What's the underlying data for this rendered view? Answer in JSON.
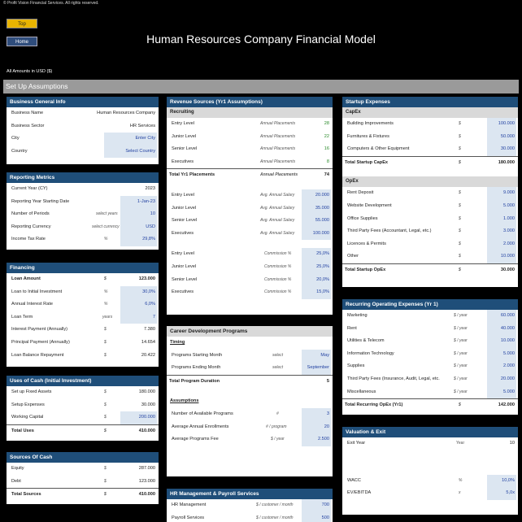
{
  "copyright": "© Profit Vision Financial Services. All rights reserved.",
  "nav": {
    "top": "Top",
    "home": "Home"
  },
  "title": "Human Resources Company Financial Model",
  "amounts": "All Amounts in  USD ($)",
  "section": "Set Up Assumptions",
  "col1": {
    "business": {
      "head": "Business General Info",
      "rows": [
        {
          "label": "Business Name",
          "value": "Human Resources Company"
        },
        {
          "label": "Business Sector",
          "value": "HR Services"
        },
        {
          "label": "City",
          "value": "Enter City"
        },
        {
          "label": "Country",
          "value": "Select Country"
        }
      ]
    },
    "reporting": {
      "head": "Reporting Metrics",
      "rows": [
        {
          "label": "Current Year (CY)",
          "unit": "",
          "value": "2023"
        },
        {
          "label": "Reporting Year Starting Date",
          "unit": "",
          "value": "1-Jan-23"
        },
        {
          "label": "Number of Periods",
          "unit": "select years",
          "value": "10"
        },
        {
          "label": "Reporting Currency",
          "unit": "select currency",
          "value": "USD"
        },
        {
          "label": "Income Tax Rate",
          "unit": "%",
          "value": "29,8%"
        }
      ]
    },
    "financing": {
      "head": "Financing",
      "rows": [
        {
          "label": "Loan Amount",
          "unit": "$",
          "value": "123.000"
        },
        {
          "label": "Loan to Initial Investment",
          "unit": "%",
          "value": "30,0%"
        },
        {
          "label": "Annual Interest Rate",
          "unit": "%",
          "value": "6,0%"
        },
        {
          "label": "Loan Term",
          "unit": "years",
          "value": "7"
        },
        {
          "label": "Interest Payment (Annually)",
          "unit": "$",
          "value": "7.380"
        },
        {
          "label": "Principal Payment (Annually)",
          "unit": "$",
          "value": "14.654"
        },
        {
          "label": "Loan Balance Repayment",
          "unit": "$",
          "value": "20.422"
        }
      ]
    },
    "uses": {
      "head": "Uses of Cash (Initial Investment)",
      "rows": [
        {
          "label": "Set up Fixed Assets",
          "unit": "$",
          "value": "180.000"
        },
        {
          "label": "Setup Expenses",
          "unit": "$",
          "value": "30.000"
        },
        {
          "label": "Working Capital",
          "unit": "$",
          "value": "200.000"
        }
      ],
      "total": {
        "label": "Total Uses",
        "unit": "$",
        "value": "410.000"
      }
    },
    "sources": {
      "head": "Sources Of Cash",
      "rows": [
        {
          "label": "Equity",
          "unit": "$",
          "value": "287.000"
        },
        {
          "label": "Debt",
          "unit": "$",
          "value": "123.000"
        }
      ],
      "total": {
        "label": "Total Sources",
        "unit": "$",
        "value": "410.000"
      }
    }
  },
  "col2": {
    "revenue": {
      "head": "Revenue Sources (Yr1 Assumptions)",
      "sub": "Recruiting",
      "placements": [
        {
          "label": "Entry Level",
          "unit": "Annual Placements",
          "value": "28"
        },
        {
          "label": "Junior Level",
          "unit": "Annual Placements",
          "value": "22"
        },
        {
          "label": "Senior Level",
          "unit": "Annual Placements",
          "value": "16"
        },
        {
          "label": "Executives",
          "unit": "Annual Placements",
          "value": "8"
        }
      ],
      "placements_total": {
        "label": "Total Yr1 Placements",
        "unit": "Annual Placements",
        "value": "74"
      },
      "salaries": [
        {
          "label": "Entry Level",
          "unit": "Avg. Annual Salary",
          "value": "20.000"
        },
        {
          "label": "Junior Level",
          "unit": "Avg. Annual Salary",
          "value": "35.000"
        },
        {
          "label": "Senior Level",
          "unit": "Avg. Annual Salary",
          "value": "55.000"
        },
        {
          "label": "Executives",
          "unit": "Avg. Annual Salary",
          "value": "100.000"
        }
      ],
      "commissions": [
        {
          "label": "Entry Level",
          "unit": "Commission %",
          "value": "25,0%"
        },
        {
          "label": "Junior Level",
          "unit": "Commission %",
          "value": "25,0%"
        },
        {
          "label": "Senior Level",
          "unit": "Commission %",
          "value": "20,0%"
        },
        {
          "label": "Executives",
          "unit": "Commission %",
          "value": "15,0%"
        }
      ]
    },
    "career": {
      "head": "Career Development Programs",
      "timing": "Timing",
      "timing_rows": [
        {
          "label": "Programs Starting Month",
          "unit": "select",
          "value": "May"
        },
        {
          "label": "Programs Ending Month",
          "unit": "select",
          "value": "September"
        }
      ],
      "duration": {
        "label": "Total Program Duration",
        "value": "5"
      },
      "assumptions": "Assumptions",
      "assumption_rows": [
        {
          "label": "Number of Available Programs",
          "unit": "#",
          "value": "3"
        },
        {
          "label": "Average Annual Enrollments",
          "unit": "# / program",
          "value": "20"
        },
        {
          "label": "Average Programs Fee",
          "unit": "$ / year",
          "value": "2.500"
        }
      ]
    },
    "hr": {
      "head": "HR Management & Payroll Services",
      "rows": [
        {
          "label": "HR Management",
          "unit": "$ / customer / month",
          "value": "700"
        },
        {
          "label": "Payroll Services",
          "unit": "$ / customer / month",
          "value": "500"
        }
      ]
    }
  },
  "col3": {
    "startup": {
      "head": "Startup Expenses",
      "capex_sub": "CapEx",
      "capex": [
        {
          "label": "Building Improvements",
          "unit": "$",
          "value": "100.000"
        },
        {
          "label": "Furnitures & Fixtures",
          "unit": "$",
          "value": "50.000"
        },
        {
          "label": "Computers & Other Equipment",
          "unit": "$",
          "value": "30.000"
        }
      ],
      "capex_total": {
        "label": "Total Startup CapEx",
        "unit": "$",
        "value": "180.000"
      },
      "opex_sub": "OpEx",
      "opex": [
        {
          "label": "Rent Deposit",
          "unit": "$",
          "value": "9.000"
        },
        {
          "label": "Website Development",
          "unit": "$",
          "value": "5.000"
        },
        {
          "label": "Office Supplies",
          "unit": "$",
          "value": "1.000"
        },
        {
          "label": "Third Party Fees (Accountant, Legal, etc.)",
          "unit": "$",
          "value": "3.000"
        },
        {
          "label": "Licences & Permits",
          "unit": "$",
          "value": "2.000"
        },
        {
          "label": "Other",
          "unit": "$",
          "value": "10.000"
        }
      ],
      "opex_total": {
        "label": "Total Startup OpEx",
        "unit": "$",
        "value": "30.000"
      }
    },
    "recurring": {
      "head": "Recurring Operating Expenses (Yr 1)",
      "rows": [
        {
          "label": "Marketing",
          "unit": "$ / year",
          "value": "60.000"
        },
        {
          "label": "Rent",
          "unit": "$ / year",
          "value": "40.000"
        },
        {
          "label": "Utilities & Telecom",
          "unit": "$ / year",
          "value": "10.000"
        },
        {
          "label": "Information Technology",
          "unit": "$ / year",
          "value": "5.000"
        },
        {
          "label": "Supplies",
          "unit": "$ / year",
          "value": "2.000"
        },
        {
          "label": "Third Party Fees (Insurance, Audit, Legal, etc.",
          "unit": "$ / year",
          "value": "20.000"
        },
        {
          "label": "Miscellaneous",
          "unit": "$ / year",
          "value": "5.000"
        }
      ],
      "total": {
        "label": "Total Recurring OpEx (Yr1)",
        "unit": "$",
        "value": "142.000"
      }
    },
    "valuation": {
      "head": "Valuation & Exit",
      "rows": [
        {
          "label": "Exit Year",
          "unit": "Year",
          "value": "10"
        },
        {
          "label": "WACC",
          "unit": "%",
          "value": "10,0%"
        },
        {
          "label": "EV/EBITDA",
          "unit": "x",
          "value": "5,0x"
        }
      ]
    }
  }
}
